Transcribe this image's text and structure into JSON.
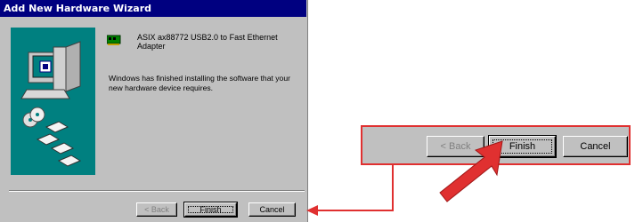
{
  "window": {
    "title": "Add New Hardware Wizard"
  },
  "device": {
    "name": "ASIX ax88772 USB2.0 to Fast Ethernet Adapter",
    "icon": "network-card-icon"
  },
  "message": "Windows has finished installing the software that your new hardware device requires.",
  "buttons": {
    "back": "< Back",
    "finish": "Finish",
    "cancel": "Cancel"
  },
  "zoom_buttons": {
    "back": "< Back",
    "finish": "Finish",
    "cancel": "Cancel"
  },
  "colors": {
    "title_bar": "#000080",
    "teal": "#008080",
    "annotation_red": "#e03030"
  }
}
